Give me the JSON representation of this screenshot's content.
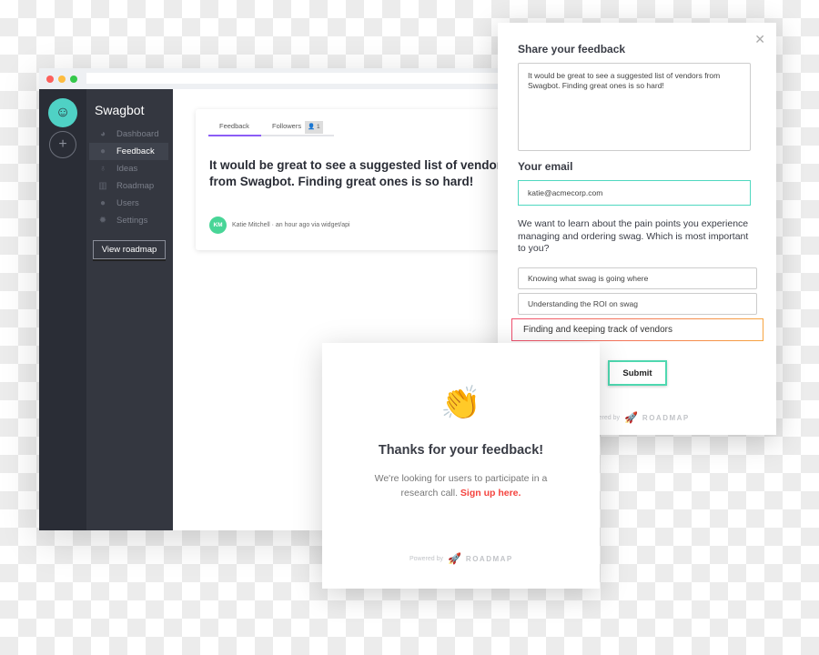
{
  "app": {
    "name": "Swagbot",
    "logo_icon": "robot-icon",
    "add_icon": "plus-icon"
  },
  "sidebar": {
    "items": [
      {
        "label": "Dashboard",
        "icon": "pie-chart-icon",
        "glyph": "◕"
      },
      {
        "label": "Feedback",
        "icon": "chat-bubbles-icon",
        "glyph": "●",
        "active": true
      },
      {
        "label": "Ideas",
        "icon": "lightbulb-icon",
        "glyph": "♁"
      },
      {
        "label": "Roadmap",
        "icon": "map-icon",
        "glyph": "▥"
      },
      {
        "label": "Users",
        "icon": "user-icon",
        "glyph": "●"
      },
      {
        "label": "Settings",
        "icon": "gear-icon",
        "glyph": "✹"
      }
    ],
    "view_roadmap": "View roadmap"
  },
  "feedback_card": {
    "tabs": [
      {
        "label": "Feedback",
        "active": true
      },
      {
        "label": "Followers",
        "badge": "1"
      }
    ],
    "title": "It would be great to see a suggested list of vendors from Swagbot. Finding great ones is so hard!",
    "avatar_initials": "KM",
    "author": "Katie Mitchell",
    "meta": " · an hour ago via widget/api"
  },
  "modal": {
    "title": "Share your feedback",
    "feedback_text": "It would be great to see a suggested list of vendors from Swagbot. Finding great ones is so hard!",
    "email_label": "Your email",
    "email_value": "katie@acmecorp.com",
    "question": "We want to learn about the pain points you experience managing and ordering swag. Which is most important to you?",
    "options": [
      "Knowing what swag is going where",
      "Understanding the ROI on swag",
      "Finding and keeping track of vendors"
    ],
    "selected_option": "Finding and keeping track of vendors",
    "submit": "Submit",
    "powered_by": "Powered by",
    "brand": "ROADMAP"
  },
  "thanks": {
    "title": "Thanks for your feedback!",
    "text": "We're looking for users to participate in a research call.",
    "link": "Sign up here.",
    "powered_by": "Powered by",
    "brand": "ROADMAP",
    "emoji": "👏"
  },
  "colors": {
    "accent_teal": "#4fd8c0",
    "tab_purple": "#8b5cf6",
    "link_red": "#f4433e",
    "avatar_green": "#48d597",
    "sidebar_dark": "#343740"
  }
}
